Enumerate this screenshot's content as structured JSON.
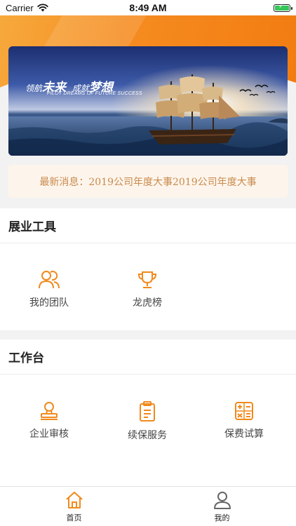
{
  "status_bar": {
    "carrier": "Carrier",
    "time": "8:49 AM"
  },
  "banner": {
    "title_part1": "领航",
    "title_part2": "未来",
    "title_part3": "成就",
    "title_part4": "梦想",
    "subtitle": "PILOT DREAMS OF FUTURE SUCCESS"
  },
  "news": {
    "text": "最新消息：2019公司年度大事2019公司年度大事"
  },
  "sections": {
    "tools": {
      "title": "展业工具",
      "items": [
        {
          "label": "我的团队",
          "icon": "team-icon"
        },
        {
          "label": "龙虎榜",
          "icon": "trophy-icon"
        }
      ]
    },
    "workbench": {
      "title": "工作台",
      "items": [
        {
          "label": "企业审核",
          "icon": "stamp-icon"
        },
        {
          "label": "续保服务",
          "icon": "clipboard-icon"
        },
        {
          "label": "保费试算",
          "icon": "calculator-icon"
        }
      ]
    }
  },
  "tabbar": {
    "tabs": [
      {
        "label": "首页",
        "icon": "home-icon",
        "active": true
      },
      {
        "label": "我的",
        "icon": "user-icon",
        "active": false
      }
    ]
  },
  "colors": {
    "accent": "#f08a1c",
    "news_text": "#c98a4d",
    "news_bg": "#fdf5ec"
  }
}
